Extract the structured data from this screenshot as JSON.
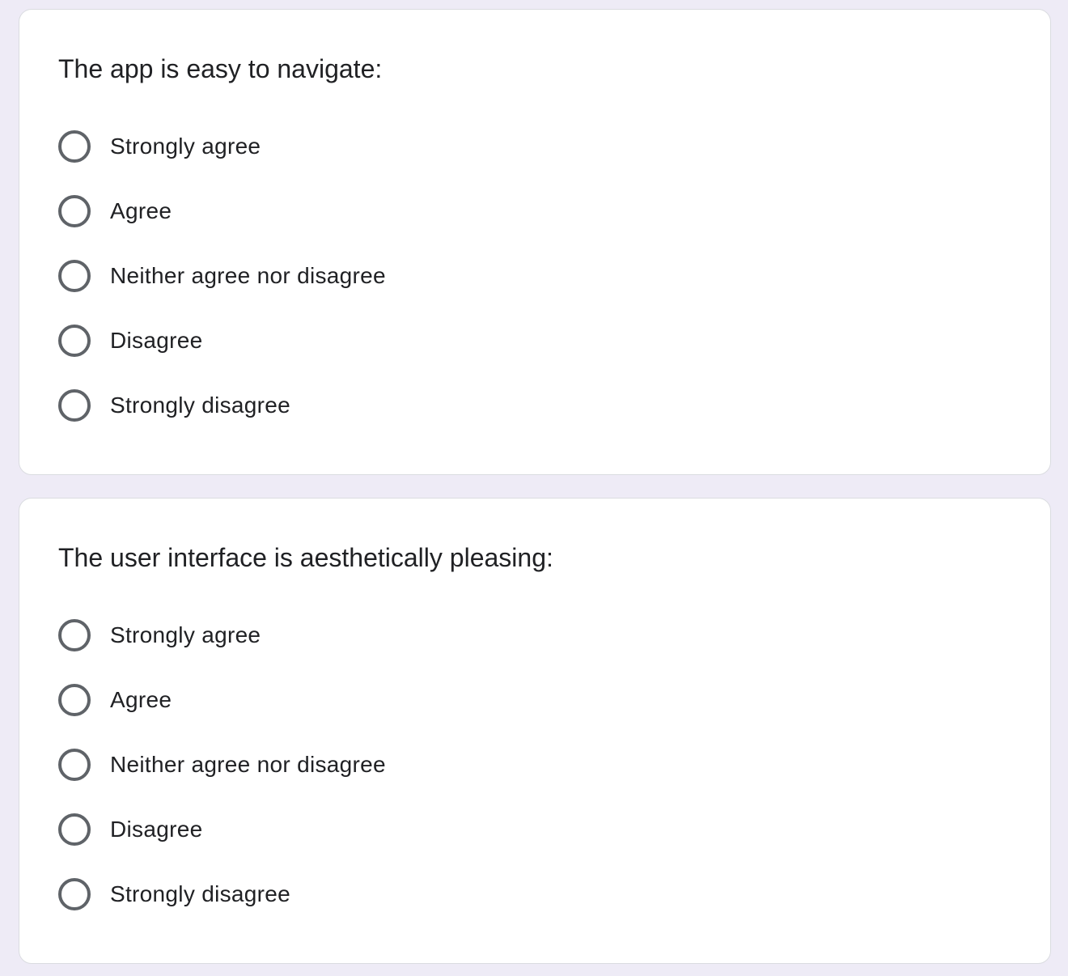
{
  "questions": [
    {
      "title": "The app is easy to navigate:",
      "options": [
        {
          "label": "Strongly agree"
        },
        {
          "label": "Agree"
        },
        {
          "label": "Neither agree nor disagree"
        },
        {
          "label": "Disagree"
        },
        {
          "label": "Strongly disagree"
        }
      ]
    },
    {
      "title": "The user interface is aesthetically pleasing:",
      "options": [
        {
          "label": "Strongly agree"
        },
        {
          "label": "Agree"
        },
        {
          "label": "Neither agree nor disagree"
        },
        {
          "label": "Disagree"
        },
        {
          "label": "Strongly disagree"
        }
      ]
    }
  ],
  "colors": {
    "page_background": "#eeebf6",
    "card_background": "#ffffff",
    "card_border": "#dadce0",
    "text": "#202124",
    "radio_border": "#5f6368"
  }
}
